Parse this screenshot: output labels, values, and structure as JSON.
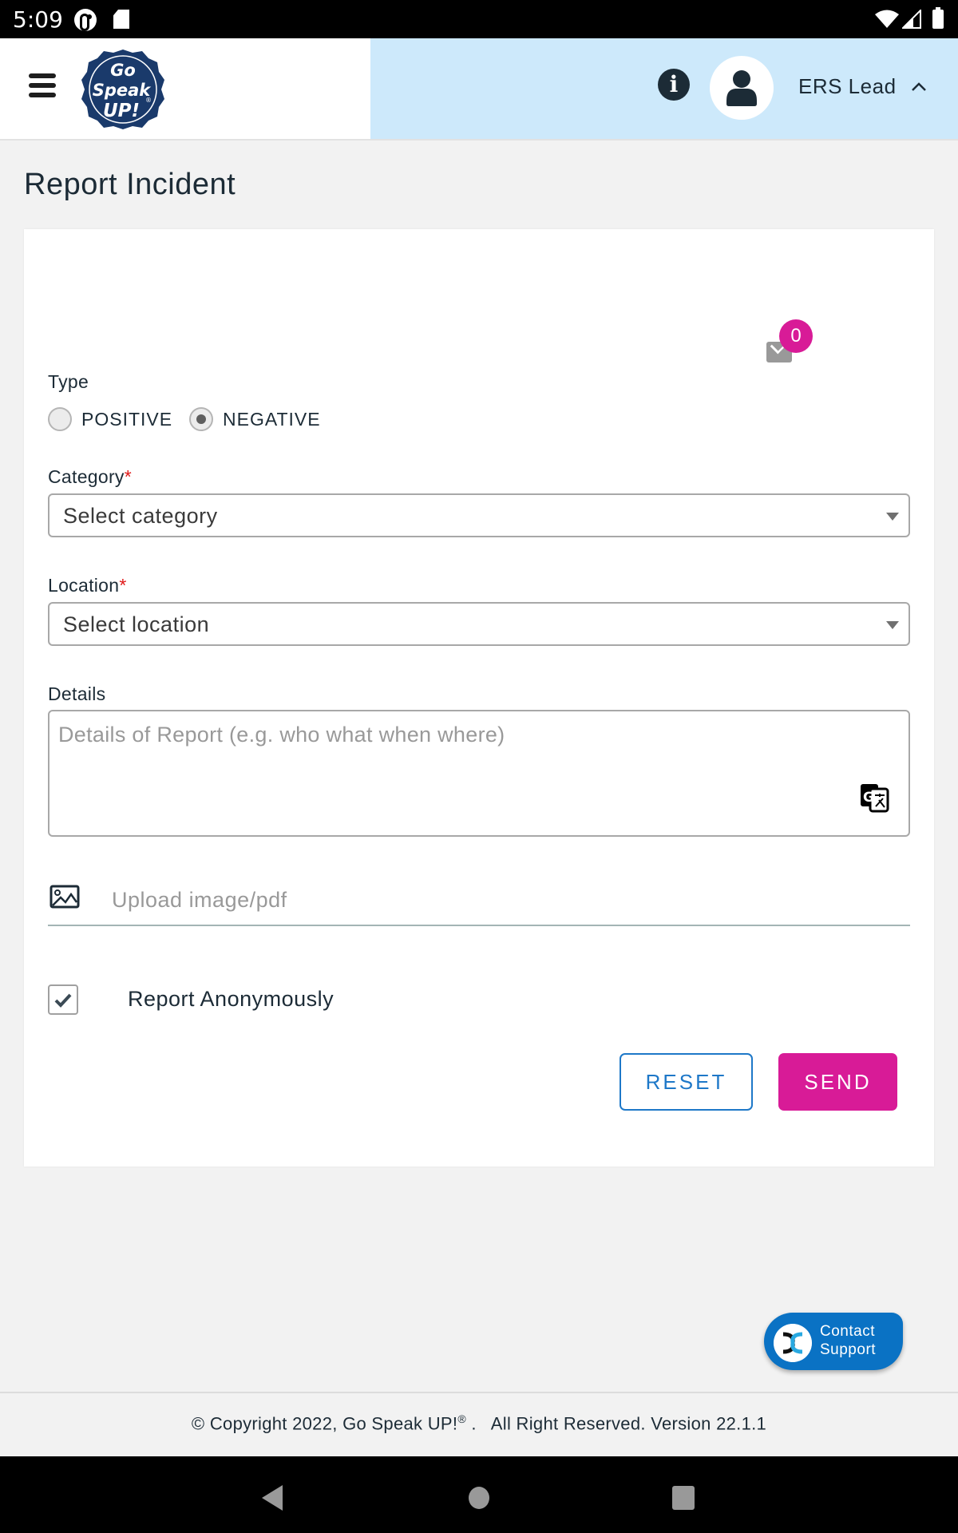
{
  "status_bar": {
    "time": "5:09",
    "icons": [
      "notification-c-icon",
      "sd-card-icon",
      "wifi-icon",
      "cell-signal-icon",
      "battery-icon"
    ]
  },
  "header": {
    "menu_icon": "hamburger-menu-icon",
    "logo": {
      "line1": "Go",
      "line2": "Speak",
      "line3": "UP!",
      "mark": "®"
    },
    "info_icon": "info-icon",
    "avatar_icon": "user-icon",
    "user_name": "ERS Lead",
    "user_menu_icon": "chevron-up-icon"
  },
  "page": {
    "title": "Report Incident"
  },
  "form": {
    "mail": {
      "icon": "mail-icon",
      "count": "0"
    },
    "type": {
      "label": "Type",
      "options": [
        {
          "label": "POSITIVE",
          "checked": false
        },
        {
          "label": "NEGATIVE",
          "checked": true
        }
      ]
    },
    "category": {
      "label": "Category",
      "required_mark": "*",
      "value": "Select category"
    },
    "location": {
      "label": "Location",
      "required_mark": "*",
      "value": "Select location"
    },
    "details": {
      "label": "Details",
      "placeholder": "Details of Report (e.g. who what when where)",
      "value": "",
      "translate_icon": "google-translate-icon"
    },
    "upload": {
      "icon": "image-icon",
      "placeholder": "Upload image/pdf"
    },
    "anonymous": {
      "label": "Report Anonymously",
      "checked": true
    },
    "buttons": {
      "reset": "RESET",
      "send": "SEND"
    }
  },
  "contact_support": {
    "line1": "Contact",
    "line2": "Support"
  },
  "footer": {
    "copyright": "© Copyright 2022, Go Speak UP!",
    "reg_mark": "®",
    "rest": " .   All Right Reserved. Version 22.1.1"
  },
  "nav_bar": {
    "back": "back-icon",
    "home": "home-icon",
    "recents": "recents-icon"
  },
  "colors": {
    "accent_magenta": "#d81b97",
    "primary_blue": "#1e78c8",
    "header_blue": "#cde9fb",
    "logo_navy": "#1a3a6b",
    "support_blue": "#0a72c4"
  }
}
